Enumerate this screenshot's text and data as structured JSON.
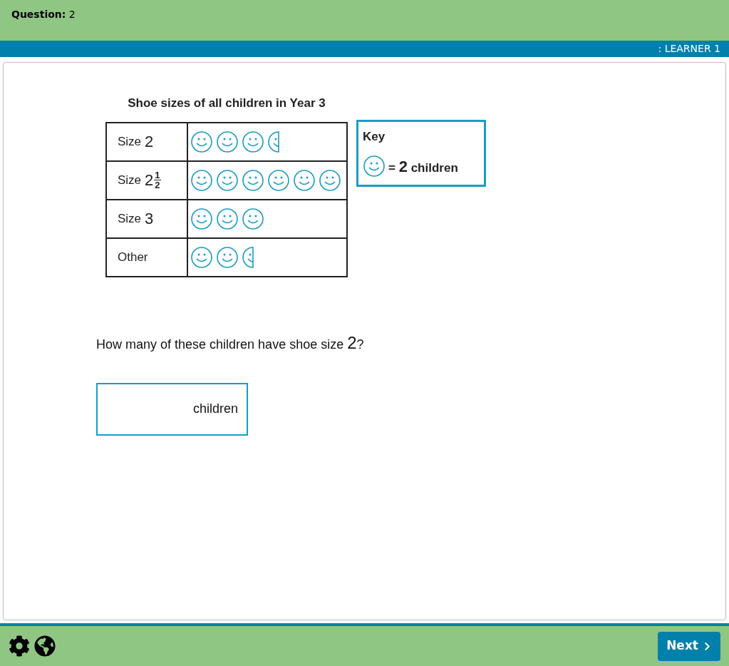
{
  "header": {
    "question_label": "Question:",
    "question_number": "2",
    "learner": ": LEARNER 1"
  },
  "pictogram": {
    "title": "Shoe sizes of all children in Year 3",
    "rows": [
      {
        "label": "Size",
        "number": "2",
        "symbols": [
          {
            "kind": "whole"
          },
          {
            "kind": "whole"
          },
          {
            "kind": "whole"
          },
          {
            "kind": "half"
          }
        ]
      },
      {
        "label": "Size",
        "number": "2",
        "fraction": {
          "numerator": "1",
          "denominator": "2"
        },
        "symbols": [
          {
            "kind": "whole"
          },
          {
            "kind": "whole"
          },
          {
            "kind": "whole"
          },
          {
            "kind": "whole"
          },
          {
            "kind": "whole"
          },
          {
            "kind": "whole"
          }
        ]
      },
      {
        "label": "Size",
        "number": "3",
        "symbols": [
          {
            "kind": "whole"
          },
          {
            "kind": "whole"
          },
          {
            "kind": "whole"
          }
        ]
      },
      {
        "label": "Other",
        "symbols": [
          {
            "kind": "whole"
          },
          {
            "kind": "whole"
          },
          {
            "kind": "half"
          }
        ]
      }
    ],
    "key": {
      "title": "Key",
      "equals": "=",
      "value": "2",
      "unit": "children"
    }
  },
  "question": {
    "text": "How many of these children have shoe size ",
    "number": "2",
    "end": "?"
  },
  "answer": {
    "suffix": "children"
  },
  "footer": {
    "next": "Next"
  }
}
